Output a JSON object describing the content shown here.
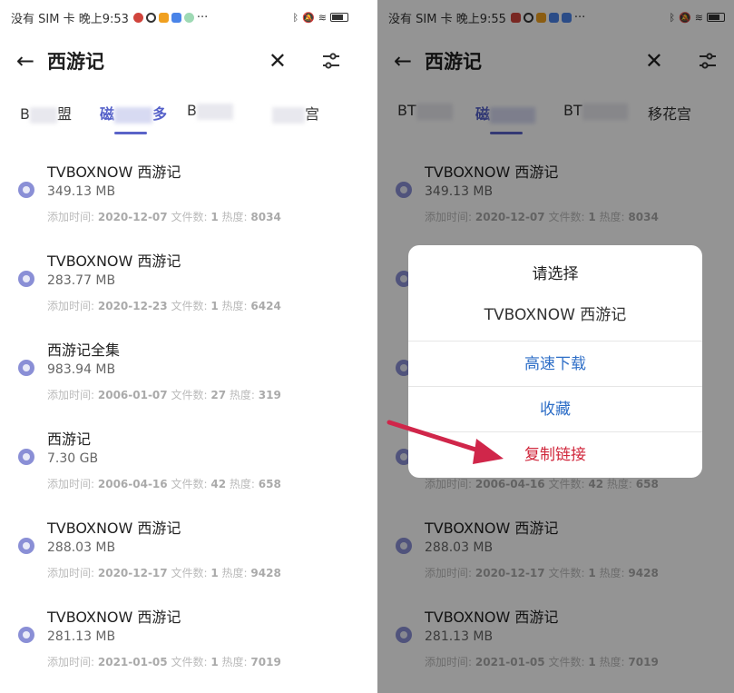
{
  "colors": {
    "accent": "#5a63c8",
    "link": "#2f6fc7",
    "danger": "#d0263b",
    "arrow": "#d0264a"
  },
  "left": {
    "status": {
      "text": "没有 SIM 卡 晚上9:53",
      "more": "···"
    },
    "header": {
      "back": "←",
      "title": "西游记",
      "close": "✕"
    },
    "tabs": {
      "t0": "B",
      "t0b": "盟",
      "t1": "磁",
      "t1b": "多",
      "t2": "B",
      "t2b": "",
      "t3b": "宫"
    },
    "items": [
      {
        "title": "TVBOXNOW 西游记",
        "size": "349.13 MB",
        "meta_pre": "添加时间:",
        "date": "2020-12-07",
        "files_label": "文件数:",
        "files": "1",
        "heat_label": "热度:",
        "heat": "8034"
      },
      {
        "title": "TVBOXNOW 西游记",
        "size": "283.77 MB",
        "meta_pre": "添加时间:",
        "date": "2020-12-23",
        "files_label": "文件数:",
        "files": "1",
        "heat_label": "热度:",
        "heat": "6424"
      },
      {
        "title": "西游记全集",
        "size": "983.94 MB",
        "meta_pre": "添加时间:",
        "date": "2006-01-07",
        "files_label": "文件数:",
        "files": "27",
        "heat_label": "热度:",
        "heat": "319"
      },
      {
        "title": "西游记",
        "size": "7.30 GB",
        "meta_pre": "添加时间:",
        "date": "2006-04-16",
        "files_label": "文件数:",
        "files": "42",
        "heat_label": "热度:",
        "heat": "658"
      },
      {
        "title": "TVBOXNOW 西游记",
        "size": "288.03 MB",
        "meta_pre": "添加时间:",
        "date": "2020-12-17",
        "files_label": "文件数:",
        "files": "1",
        "heat_label": "热度:",
        "heat": "9428"
      },
      {
        "title": "TVBOXNOW 西游记",
        "size": "281.13 MB",
        "meta_pre": "添加时间:",
        "date": "2021-01-05",
        "files_label": "文件数:",
        "files": "1",
        "heat_label": "热度:",
        "heat": "7019"
      }
    ]
  },
  "right": {
    "status": {
      "text": "没有 SIM 卡 晚上9:55",
      "more": "···"
    },
    "header": {
      "back": "←",
      "title": "西游记",
      "close": "✕"
    },
    "tabs": {
      "t0": "BT",
      "t1": "磁",
      "t2": "BT",
      "t3": "移花宫"
    },
    "items": [
      {
        "title": "TVBOXNOW 西游记",
        "size": "349.13 MB",
        "meta_pre": "添加时间:",
        "date": "2020-12-07",
        "files_label": "文件数:",
        "files": "1",
        "heat_label": "热度:",
        "heat": "8034"
      },
      {
        "title": "",
        "size": "",
        "meta_pre": "",
        "date": "",
        "files_label": "",
        "files": "",
        "heat_label": "",
        "heat": ""
      },
      {
        "title": "",
        "size": "",
        "meta_pre": "",
        "date": "",
        "files_label": "",
        "files": "",
        "heat_label": "",
        "heat": ""
      },
      {
        "title": "",
        "size": "",
        "meta_pre": "添加时间:",
        "date": "2006-04-16",
        "files_label": "文件数:",
        "files": "42",
        "heat_label": "热度:",
        "heat": "658"
      },
      {
        "title": "TVBOXNOW 西游记",
        "size": "288.03 MB",
        "meta_pre": "添加时间:",
        "date": "2020-12-17",
        "files_label": "文件数:",
        "files": "1",
        "heat_label": "热度:",
        "heat": "9428"
      },
      {
        "title": "TVBOXNOW 西游记",
        "size": "281.13 MB",
        "meta_pre": "添加时间:",
        "date": "2021-01-05",
        "files_label": "文件数:",
        "files": "1",
        "heat_label": "热度:",
        "heat": "7019"
      }
    ],
    "dialog": {
      "title": "请选择",
      "subtitle": "TVBOXNOW 西游记",
      "options": [
        "高速下载",
        "收藏",
        "复制链接"
      ]
    }
  }
}
